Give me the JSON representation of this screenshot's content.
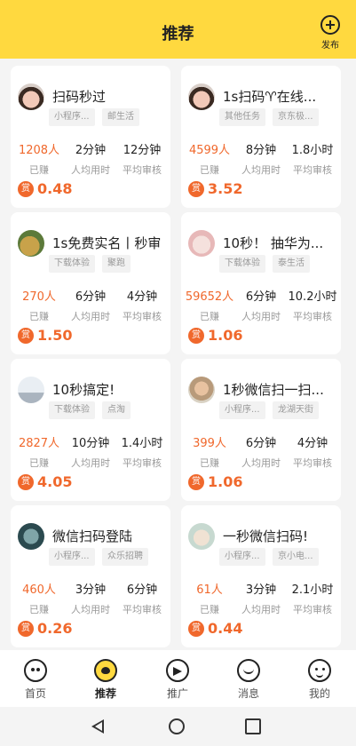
{
  "header": {
    "title": "推荐",
    "publish_label": "发布"
  },
  "tasks": [
    {
      "title": "扫码秒过",
      "tags": [
        "小程序...",
        "邮生活"
      ],
      "stats": [
        "1208人",
        "2分钟",
        "12分钟"
      ],
      "labels": [
        "已赚",
        "人均用时",
        "平均审核"
      ],
      "badge": "赏",
      "reward": "0.48"
    },
    {
      "title": "1s扫码♈在线...",
      "tags": [
        "其他任务",
        "京东极..."
      ],
      "stats": [
        "4599人",
        "8分钟",
        "1.8小时"
      ],
      "labels": [
        "已赚",
        "人均用时",
        "平均审核"
      ],
      "badge": "赏",
      "reward": "3.52"
    },
    {
      "title": "1s免费实名丨秒审",
      "tags": [
        "下载体验",
        "聚跑"
      ],
      "stats": [
        "270人",
        "6分钟",
        "4分钟"
      ],
      "labels": [
        "已赚",
        "人均用时",
        "平均审核"
      ],
      "badge": "赏",
      "reward": "1.50"
    },
    {
      "title": "10秒！ 抽华为...",
      "tags": [
        "下载体验",
        "泰生活"
      ],
      "stats": [
        "59652人",
        "6分钟",
        "10.2小时"
      ],
      "labels": [
        "已赚",
        "人均用时",
        "平均审核"
      ],
      "badge": "赏",
      "reward": "1.06"
    },
    {
      "title": "10秒搞定!",
      "tags": [
        "下载体验",
        "点淘"
      ],
      "stats": [
        "2827人",
        "10分钟",
        "1.4小时"
      ],
      "labels": [
        "已赚",
        "人均用时",
        "平均审核"
      ],
      "badge": "赏",
      "reward": "4.05"
    },
    {
      "title": "1秒微信扫一扫...",
      "tags": [
        "小程序...",
        "龙湖天街"
      ],
      "stats": [
        "399人",
        "6分钟",
        "4分钟"
      ],
      "labels": [
        "已赚",
        "人均用时",
        "平均审核"
      ],
      "badge": "赏",
      "reward": "1.06"
    },
    {
      "title": "微信扫码登陆",
      "tags": [
        "小程序...",
        "众乐招聘"
      ],
      "stats": [
        "460人",
        "3分钟",
        "6分钟"
      ],
      "labels": [
        "已赚",
        "人均用时",
        "平均审核"
      ],
      "badge": "赏",
      "reward": "0.26"
    },
    {
      "title": "一秒微信扫码!",
      "tags": [
        "小程序...",
        "京小电..."
      ],
      "stats": [
        "61人",
        "3分钟",
        "2.1小时"
      ],
      "labels": [
        "已赚",
        "人均用时",
        "平均审核"
      ],
      "badge": "赏",
      "reward": "0.44"
    }
  ],
  "tabbar": [
    {
      "label": "首页",
      "icon": "cat-icon"
    },
    {
      "label": "推荐",
      "icon": "heart-bubble-icon"
    },
    {
      "label": "推广",
      "icon": "send-icon"
    },
    {
      "label": "消息",
      "icon": "chat-icon"
    },
    {
      "label": "我的",
      "icon": "smile-icon"
    }
  ],
  "active_tab": "推荐",
  "colors": {
    "brand_yellow": "#ffd93f",
    "accent_orange": "#f0682c"
  }
}
